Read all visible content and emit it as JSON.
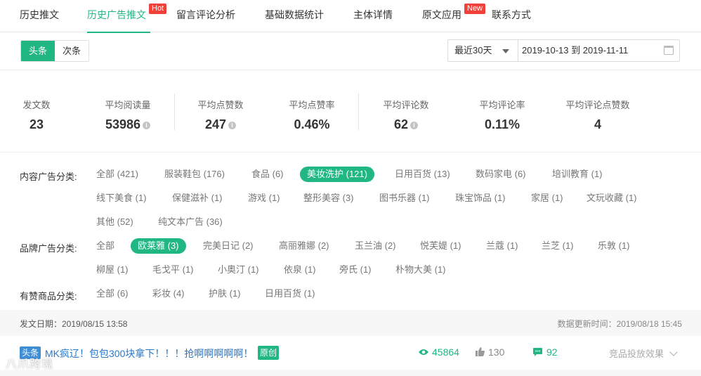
{
  "nav": {
    "tabs": [
      {
        "label": "历史推文"
      },
      {
        "label": "历史广告推文",
        "badge": "Hot"
      },
      {
        "label": "留言评论分析"
      },
      {
        "label": "基础数据统计"
      },
      {
        "label": "主体详情"
      },
      {
        "label": "原文应用",
        "badge": "New"
      },
      {
        "label": "联系方式"
      }
    ],
    "active_tab": "历史广告推文"
  },
  "toolbar": {
    "segments": [
      "头条",
      "次条"
    ],
    "active_segment": "头条",
    "period_select": "最近30天",
    "date_range": "2019-10-13 到 2019-11-11"
  },
  "stats": [
    {
      "label": "发文数",
      "value": "23"
    },
    {
      "label": "平均阅读量",
      "value": "53986"
    },
    {
      "label": "平均点赞数",
      "value": "247"
    },
    {
      "label": "平均点赞率",
      "value": "0.46%"
    },
    {
      "label": "平均评论数",
      "value": "62"
    },
    {
      "label": "平均评论率",
      "value": "0.11%"
    },
    {
      "label": "平均评论点赞数",
      "value": "4"
    }
  ],
  "filters": {
    "content": {
      "label": "内容广告分类:",
      "items": [
        "全部 (421)",
        "服装鞋包 (176)",
        "食品 (6)",
        "美妆洗护 (121)",
        "日用百货 (13)",
        "数码家电 (6)",
        "培训教育 (1)",
        "线下美食 (1)",
        "保健滋补 (1)",
        "游戏 (1)",
        "整形美容 (3)",
        "图书乐器 (1)",
        "珠宝饰品 (1)",
        "家居 (1)",
        "文玩收藏 (1)",
        "其他 (52)",
        "纯文本广告 (36)"
      ],
      "selected": "美妆洗护 (121)"
    },
    "brand": {
      "label": "品牌广告分类:",
      "items": [
        "全部",
        "欧莱雅 (3)",
        "完美日记 (2)",
        "高丽雅娜 (2)",
        "玉兰油 (2)",
        "悦芙媞 (1)",
        "兰蔻 (1)",
        "兰芝 (1)",
        "乐敦 (1)",
        "柳屋 (1)",
        "毛戈平 (1)",
        "小奥汀 (1)",
        "依泉 (1)",
        "旁氏 (1)",
        "朴物大美 (1)"
      ],
      "selected": "欧莱雅 (3)"
    },
    "goods": {
      "label": "有赞商品分类:",
      "items": [
        "全部 (6)",
        "彩妆 (4)",
        "护肤 (1)",
        "日用百货 (1)"
      ]
    }
  },
  "article": {
    "publish_date": "发文日期：2019/08/15 13:58",
    "updated": "数据更新时间：2019/08/18 15:45",
    "position_tag": "头条",
    "title": "MK疯辽！包包300块拿下！！！抢啊啊啊啊啊！",
    "original_tag": "原创",
    "views": "45864",
    "likes": "130",
    "comments": "92",
    "compete_label": "竞品投放效果"
  },
  "watermark": "八爪跨境",
  "colors": {
    "accent": "#21b783",
    "badge": "#f0413b",
    "link": "#2a78c7",
    "head_tag": "#3e8ed6"
  }
}
